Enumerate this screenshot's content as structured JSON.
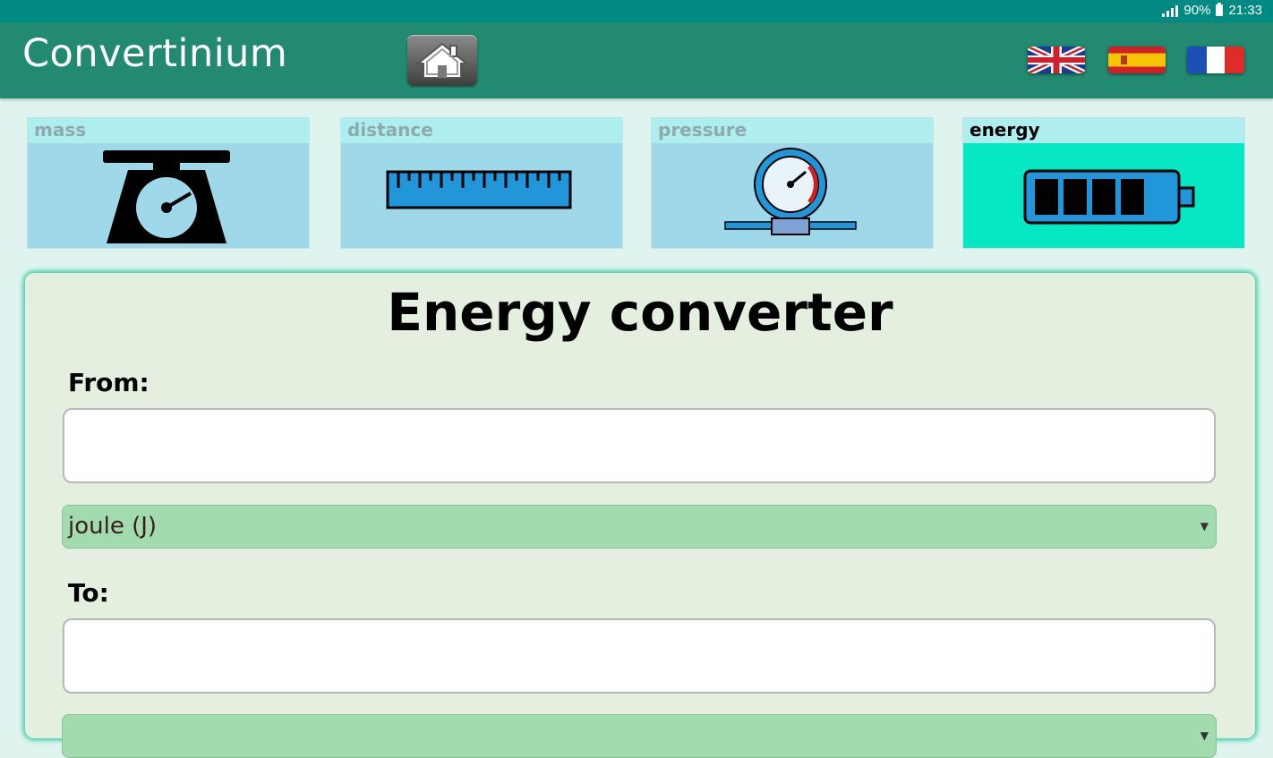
{
  "status": {
    "battery": "90%",
    "time": "21:33"
  },
  "header": {
    "title": "Convertinium"
  },
  "categories": [
    {
      "label": "mass",
      "icon": "scale-icon",
      "active": false
    },
    {
      "label": "distance",
      "icon": "ruler-icon",
      "active": false
    },
    {
      "label": "pressure",
      "icon": "pressure-gauge-icon",
      "active": false
    },
    {
      "label": "energy",
      "icon": "battery-icon",
      "active": true
    }
  ],
  "converter": {
    "title": "Energy converter",
    "from_label": "From:",
    "from_value": "",
    "from_unit": "joule (J)",
    "to_label": "To:",
    "to_value": ""
  },
  "colors": {
    "status_bar": "#008a84",
    "app_bar": "#218a70",
    "tile": "#9fd8e8",
    "tile_active": "#06e8c4",
    "card": "#e4efe0",
    "select": "#a2dbae"
  }
}
